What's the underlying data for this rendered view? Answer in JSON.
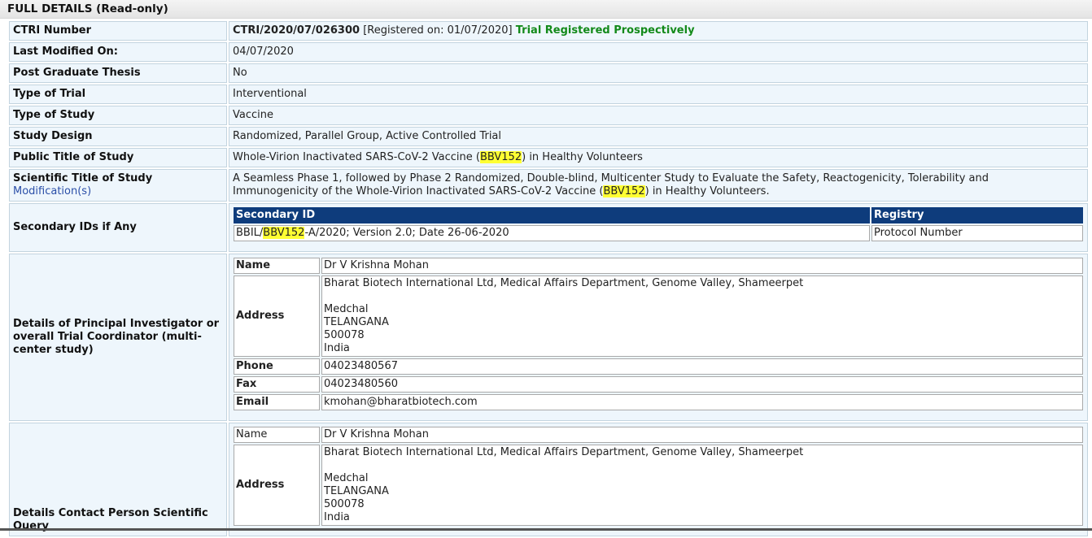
{
  "header": {
    "title": "FULL DETAILS (Read-only)"
  },
  "rows": {
    "ctri": {
      "label": "CTRI Number",
      "number": "CTRI/2020/07/026300",
      "registered": "[Registered on: 01/07/2020]",
      "status": "Trial Registered Prospectively"
    },
    "modified": {
      "label": "Last Modified On:",
      "value": "04/07/2020"
    },
    "thesis": {
      "label": "Post Graduate Thesis",
      "value": "No"
    },
    "trial_type": {
      "label": "Type of Trial",
      "value": "Interventional"
    },
    "study_type": {
      "label": "Type of Study",
      "value": "Vaccine"
    },
    "design": {
      "label": "Study Design",
      "value": "Randomized, Parallel Group, Active Controlled Trial"
    },
    "public_title": {
      "label": "Public Title of Study",
      "pre": "Whole-Virion Inactivated SARS-CoV-2 Vaccine (",
      "highlight": "BBV152",
      "post": ") in Healthy Volunteers"
    },
    "sci_title": {
      "label": "Scientific Title of Study",
      "link": "Modification(s)",
      "line1": "A Seamless Phase 1, followed by Phase 2 Randomized, Double-blind, Multicenter Study to Evaluate the Safety, Reactogenicity, Tolerability and",
      "line2_pre": "Immunogenicity of the Whole-Virion Inactivated SARS-CoV-2 Vaccine (",
      "highlight": "BBV152",
      "line2_post": ") in Healthy Volunteers."
    },
    "secondary": {
      "label": "Secondary IDs if Any",
      "col1": "Secondary ID",
      "col2": "Registry",
      "id_pre": "BBIL/",
      "id_hl": "BBV152",
      "id_post": "-A/2020; Version 2.0; Date 26-06-2020",
      "registry": "Protocol Number"
    },
    "pi": {
      "label": "Details of Principal Investigator or overall Trial Coordinator (multi-center study)",
      "name_label": "Name",
      "name": "Dr V Krishna Mohan",
      "address_label": "Address",
      "address": [
        "Bharat Biotech International Ltd, Medical Affairs Department, Genome Valley, Shameerpet",
        "",
        "Medchal",
        "TELANGANA",
        "500078",
        "India"
      ],
      "phone_label": "Phone",
      "phone": "04023480567",
      "fax_label": "Fax",
      "fax": "04023480560",
      "email_label": "Email",
      "email": "kmohan@bharatbiotech.com"
    },
    "contact": {
      "label": "Details Contact Person Scientific Query",
      "name_label": "Name",
      "name": "Dr V Krishna Mohan",
      "address_label": "Address",
      "address": [
        "Bharat Biotech International Ltd, Medical Affairs Department, Genome Valley, Shameerpet",
        "",
        "Medchal",
        "TELANGANA",
        "500078",
        "India"
      ]
    }
  }
}
